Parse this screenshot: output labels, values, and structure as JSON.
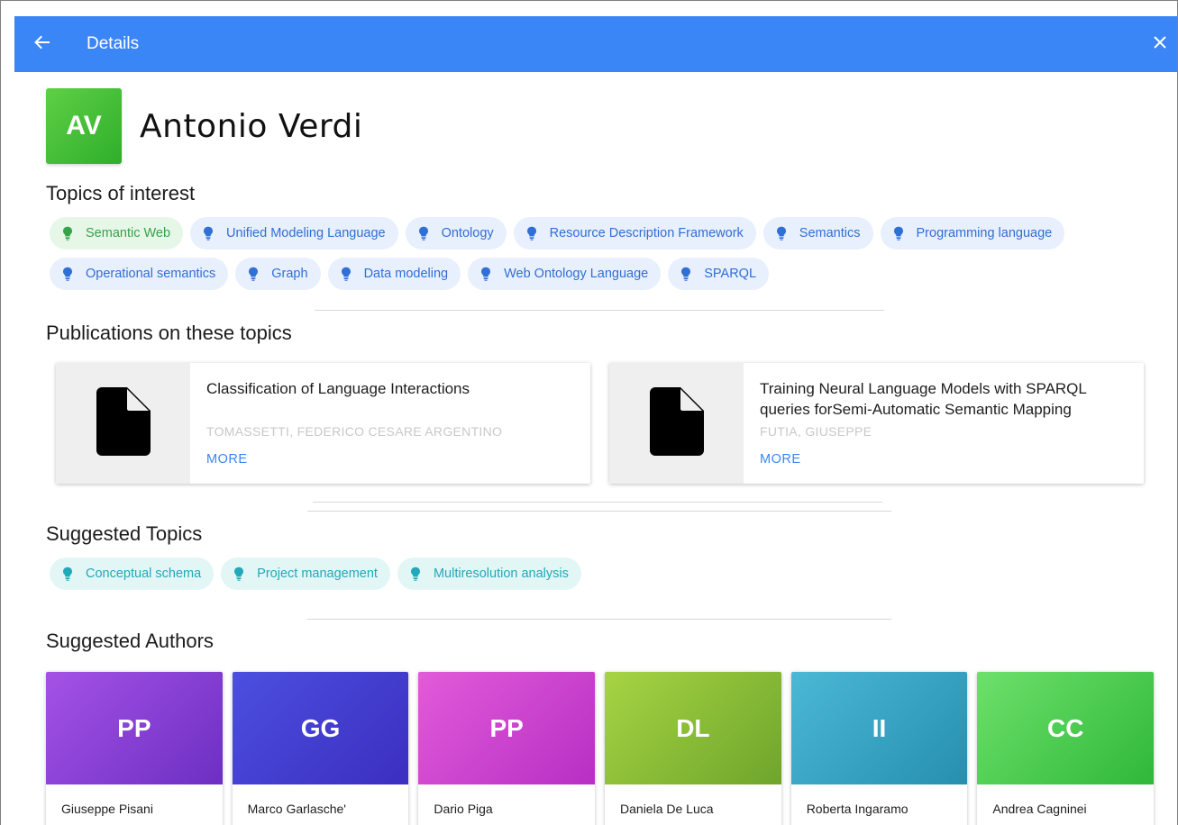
{
  "header": {
    "back_icon": "arrow-left-icon",
    "title": "Details",
    "close_icon": "close-icon",
    "bar_color": "#3a86f7"
  },
  "profile": {
    "initials": "AV",
    "name": "Antonio Verdi"
  },
  "topics_of_interest": {
    "title": "Topics of interest",
    "chips": [
      {
        "label": "Semantic Web",
        "variant": "green"
      },
      {
        "label": "Unified Modeling Language",
        "variant": "blue"
      },
      {
        "label": "Ontology",
        "variant": "blue"
      },
      {
        "label": "Resource Description Framework",
        "variant": "blue"
      },
      {
        "label": "Semantics",
        "variant": "blue"
      },
      {
        "label": "Programming language",
        "variant": "blue"
      },
      {
        "label": "Operational semantics",
        "variant": "blue"
      },
      {
        "label": "Graph",
        "variant": "blue"
      },
      {
        "label": "Data modeling",
        "variant": "blue"
      },
      {
        "label": "Web Ontology Language",
        "variant": "blue"
      },
      {
        "label": "SPARQL",
        "variant": "blue"
      }
    ]
  },
  "publications": {
    "title": "Publications on these topics",
    "items": [
      {
        "title": "Classification of Language Interactions",
        "authors": "TOMASSETTI, FEDERICO CESARE ARGENTINO",
        "more": "MORE"
      },
      {
        "title": "Training Neural Language Models with SPARQL queries forSemi-Automatic Semantic Mapping",
        "authors": "FUTIA, GIUSEPPE",
        "more": "MORE"
      }
    ]
  },
  "suggested_topics": {
    "title": "Suggested Topics",
    "chips": [
      {
        "label": "Conceptual schema",
        "variant": "teal"
      },
      {
        "label": "Project management",
        "variant": "teal"
      },
      {
        "label": "Multiresolution analysis",
        "variant": "teal"
      }
    ]
  },
  "suggested_authors": {
    "title": "Suggested Authors",
    "items": [
      {
        "initials": "PP",
        "name": "Giuseppe Pisani",
        "from": "#a552e6",
        "to": "#6c2fc2"
      },
      {
        "initials": "GG",
        "name": "Marco Garlasche'",
        "from": "#4c4fdf",
        "to": "#3b2ec0"
      },
      {
        "initials": "PP",
        "name": "Dario Piga",
        "from": "#e25bd9",
        "to": "#b72fc4"
      },
      {
        "initials": "DL",
        "name": "Daniela De Luca",
        "from": "#a6d443",
        "to": "#6ea52b"
      },
      {
        "initials": "II",
        "name": "Roberta Ingaramo",
        "from": "#4bb8d6",
        "to": "#268fb0"
      },
      {
        "initials": "CC",
        "name": "Andrea Cagninei",
        "from": "#6ee06b",
        "to": "#2fb83a"
      }
    ]
  }
}
